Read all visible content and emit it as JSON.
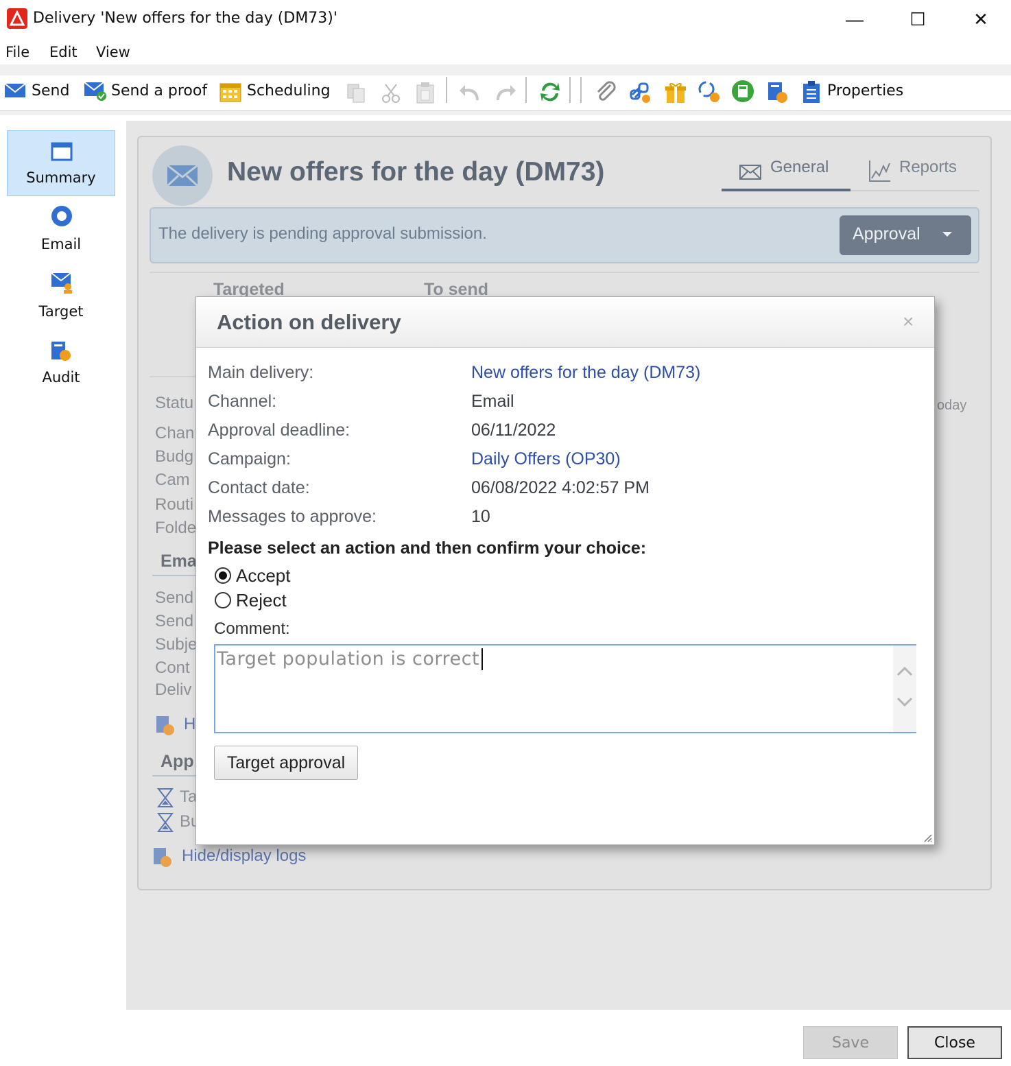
{
  "window": {
    "title": "Delivery 'New offers for the day (DM73)'",
    "controls": {
      "minimize": "—",
      "maximize": "☐",
      "close": "✕"
    }
  },
  "menu": [
    "File",
    "Edit",
    "View"
  ],
  "toolbar": {
    "send": "Send",
    "send_proof": "Send a proof",
    "scheduling": "Scheduling",
    "properties": "Properties",
    "icons": [
      "copy-icon",
      "cut-icon",
      "paste-icon",
      "undo-icon",
      "redo-icon",
      "refresh-icon",
      "attachment-icon",
      "link-icon",
      "gift-icon",
      "offers-icon",
      "calculator-icon",
      "audit-icon",
      "properties-icon"
    ]
  },
  "nav": {
    "summary": "Summary",
    "email": "Email",
    "target": "Target",
    "audit": "Audit"
  },
  "header": {
    "title": "New offers for the day (DM73)",
    "tab_general": "General",
    "tab_reports": "Reports"
  },
  "status": {
    "text": "The delivery is pending approval submission.",
    "approval_button": "Approval"
  },
  "background": {
    "col_targeted": "Targeted",
    "col_to_send": "To send",
    "today": "oday",
    "labels": [
      "Statu",
      "Chan",
      "Budg",
      "Cam",
      "Routi",
      "Folde"
    ],
    "email_section": "Ema",
    "email_labels": [
      "Send",
      "Send",
      "Subje",
      "Cont",
      "Deliv"
    ],
    "history_link": "H",
    "approval_section": "App",
    "approval_items": [
      "Ta",
      "Bu"
    ],
    "logs_link": "Hide/display logs"
  },
  "dialog": {
    "title": "Action on delivery",
    "close": "×",
    "fields": {
      "main_delivery_label": "Main delivery:",
      "main_delivery_value": "New offers for the day (DM73)",
      "channel_label": "Channel:",
      "channel_value": "Email",
      "deadline_label": "Approval deadline:",
      "deadline_value": "06/11/2022",
      "campaign_label": "Campaign:",
      "campaign_value": "Daily Offers (OP30)",
      "contact_label": "Contact date:",
      "contact_value": "06/08/2022 4:02:57 PM",
      "messages_label": "Messages to approve:",
      "messages_value": "10"
    },
    "prompt": "Please select an action and then confirm your choice:",
    "options": {
      "accept": "Accept",
      "reject": "Reject",
      "selected": "Accept"
    },
    "comment_label": "Comment:",
    "comment_value": "Target population is correct",
    "target_approval_button": "Target approval"
  },
  "footer": {
    "save": "Save",
    "close": "Close"
  }
}
